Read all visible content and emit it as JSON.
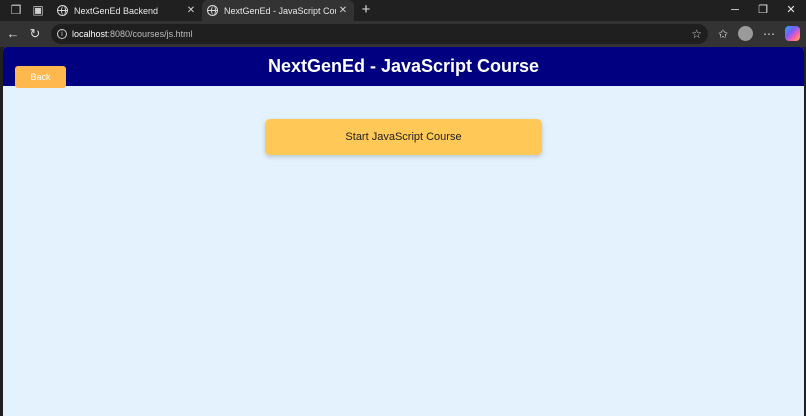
{
  "browser": {
    "tabs": [
      {
        "title": "NextGenEd Backend",
        "active": false
      },
      {
        "title": "NextGenEd - JavaScript Course",
        "active": true
      }
    ],
    "address": {
      "host": "localhost",
      "path": ":8080/courses/js.html"
    }
  },
  "page": {
    "header_title": "NextGenEd - JavaScript Course",
    "back_label": "Back",
    "start_label": "Start JavaScript Course"
  },
  "colors": {
    "header_bg": "#000080",
    "page_bg": "#e3f2fd",
    "back_button": "#ffb84d",
    "start_button": "#ffc857"
  }
}
